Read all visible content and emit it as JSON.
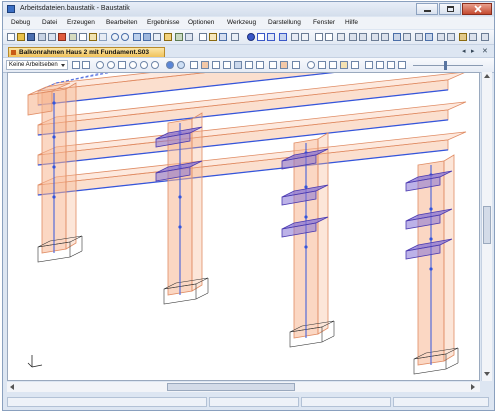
{
  "window": {
    "title": "Arbeitsdateien.baustatik - Baustatik"
  },
  "menu": [
    "Debug",
    "Datei",
    "Erzeugen",
    "Bearbeiten",
    "Ergebnisse",
    "Optionen",
    "Werkzeug",
    "Darstellung",
    "Fenster",
    "Hilfe"
  ],
  "document_tab": {
    "label": "Balkonrahmen Haus 2 mit Fundament.S03"
  },
  "view_toolbar": {
    "layer_select_value": "Keine Arbeitseben"
  },
  "colors": {
    "member_fill": "#f7b792",
    "member_edge": "#e08c64",
    "slab_fill": "#8573d6",
    "wire": "#3355dd",
    "dash": "#5a74e0"
  }
}
